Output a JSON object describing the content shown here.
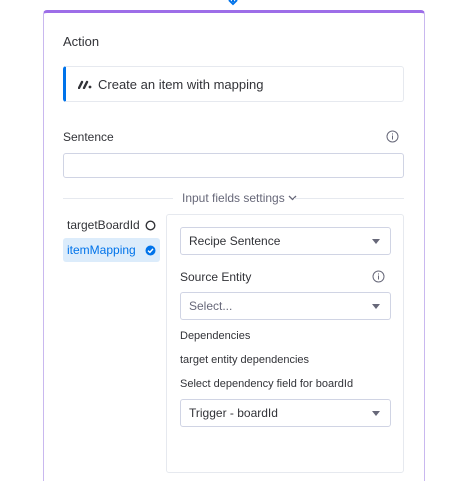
{
  "panel": {
    "title": "Action",
    "action_text": "Create an item with mapping",
    "action_logo_icon": "monday-logo-icon"
  },
  "sentence": {
    "label": "Sentence",
    "value": "",
    "info_icon": "info-icon"
  },
  "input_fields": {
    "settings_label": "Input fields settings",
    "fields": [
      {
        "label": "targetBoardId",
        "status": "incomplete",
        "status_icon": "empty-circle-icon"
      },
      {
        "label": "itemMapping",
        "status": "complete",
        "status_icon": "check-circle-icon",
        "selected": true
      }
    ]
  },
  "config": {
    "type_select": "Recipe Sentence",
    "source_entity_label": "Source Entity",
    "source_entity_placeholder": "Select...",
    "dependencies_label": "Dependencies",
    "target_entity_label": "target entity dependencies",
    "select_dependency_label": "Select dependency field for boardId",
    "dependency_select": "Trigger - boardId"
  },
  "colors": {
    "accent": "#9d6ee8",
    "primary": "#0073ea",
    "selected_bg": "#dcecfb"
  }
}
